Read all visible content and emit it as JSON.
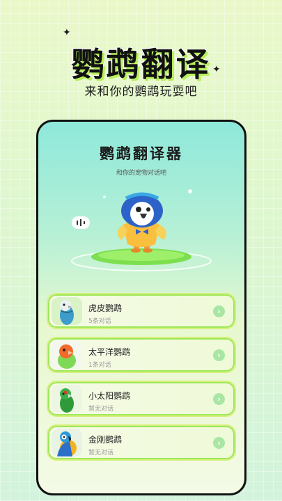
{
  "header": {
    "title": "鹦鹉翻译",
    "subtitle": "来和你的鹦鹉玩耍吧"
  },
  "card": {
    "title": "鹦鹉翻译器",
    "subtitle": "和你的宠物对话吧"
  },
  "parrots": [
    {
      "name": "虎皮鹦鹉",
      "meta": "5条对话",
      "icon": "budgie-photo"
    },
    {
      "name": "太平洋鹦鹉",
      "meta": "1条对话",
      "icon": "lovebird-photo"
    },
    {
      "name": "小太阳鹦鹉",
      "meta": "暂无对话",
      "icon": "conure-photo"
    },
    {
      "name": "金刚鹦鹉",
      "meta": "暂无对话",
      "icon": "macaw-photo"
    }
  ],
  "colors": {
    "accent_green": "#b7f05a",
    "arrow_green": "#a9e6a3",
    "card_top": "#8ee8da"
  }
}
